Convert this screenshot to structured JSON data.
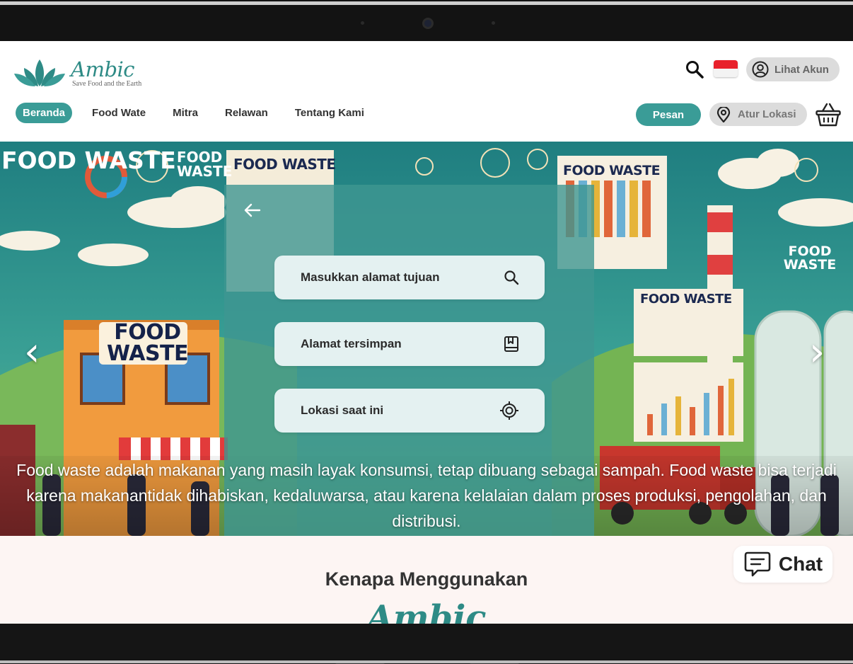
{
  "brand": {
    "name": "Ambic",
    "tagline": "Save Food and the Earth",
    "primary_color": "#3a9c97"
  },
  "header": {
    "account_label": "Lihat Akun",
    "order_label": "Pesan",
    "location_label": "Atur Lokasi",
    "flag": "Indonesia"
  },
  "nav": {
    "items": [
      {
        "label": "Beranda",
        "active": true
      },
      {
        "label": "Food Wate",
        "active": false
      },
      {
        "label": "Mitra",
        "active": false
      },
      {
        "label": "Relawan",
        "active": false
      },
      {
        "label": "Tentang Kami",
        "active": false
      }
    ]
  },
  "hero": {
    "posters": {
      "left_top": "FOOD WASTE",
      "board_1": "FOOD WASTE",
      "board_2": "FOOD WASTE",
      "board_3": "FOOD WASTE",
      "shop_sign": "FOOD WASTE",
      "small_1": "FOOD WASTE",
      "right_label": "FOOD WASTE"
    },
    "caption": "Food waste adalah makanan yang masih layak konsumsi, tetap dibuang sebagai sampah. Food waste bisa terjadi karena makanantidak dihabiskan, kedaluwarsa, atau karena kelalaian dalam proses produksi, pengolahan, dan distribusi.",
    "prev_icon": "‹",
    "next_icon": "›"
  },
  "location_modal": {
    "options": [
      {
        "label": "Masukkan alamat tujuan",
        "icon": "search-icon"
      },
      {
        "label": "Alamat tersimpan",
        "icon": "bookmark-icon"
      },
      {
        "label": "Lokasi saat ini",
        "icon": "crosshair-icon"
      }
    ]
  },
  "why_section": {
    "title": "Kenapa Menggunakan",
    "brand": "Ambic"
  },
  "chat": {
    "label": "Chat"
  }
}
